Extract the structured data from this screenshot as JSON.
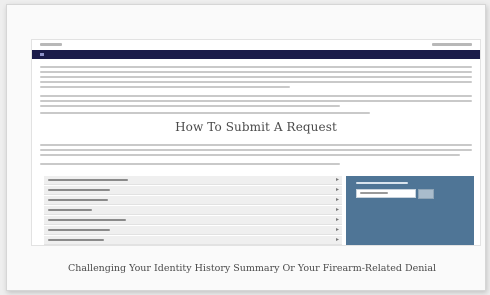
{
  "page": {
    "heading": "How To Submit A Request",
    "caption": "Challenging Your Identity History Summary Or Your Firearm-Related Denial"
  },
  "colors": {
    "navbar": "#1b1c4a",
    "panel": "#4f7596",
    "step_row": "#efefef",
    "text": "#4a4a4a"
  },
  "icons": {
    "step_arrow": "chevron-right-icon"
  }
}
